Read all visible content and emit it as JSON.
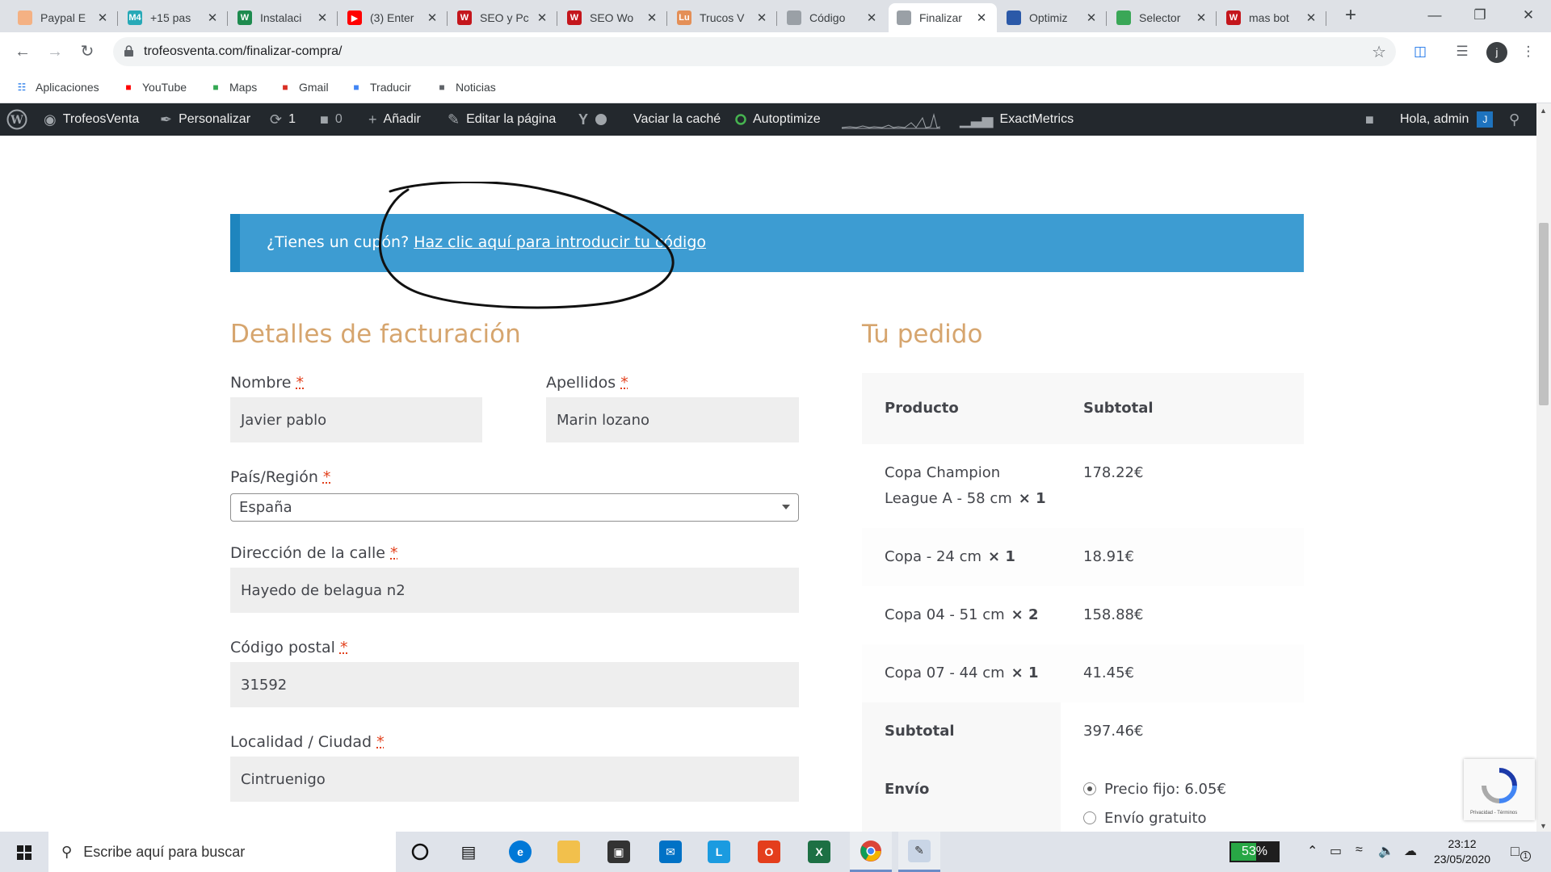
{
  "browser": {
    "tabs": [
      {
        "title": "Paypal E",
        "icon": "paypal-icon",
        "color": "#f4b183",
        "glyph": ""
      },
      {
        "title": "+15 pas",
        "icon": "m4-icon",
        "color": "#27a9b7",
        "glyph": "M4"
      },
      {
        "title": "Instalaci",
        "icon": "webempresa-icon",
        "color": "#1e8b4f",
        "glyph": "W"
      },
      {
        "title": "(3) Enter",
        "icon": "youtube-icon",
        "color": "#ff0000",
        "glyph": "▶"
      },
      {
        "title": "SEO y Pc",
        "icon": "webempresa-red-icon",
        "color": "#c4161c",
        "glyph": "W"
      },
      {
        "title": "SEO Wo",
        "icon": "webempresa-red-icon",
        "color": "#c4161c",
        "glyph": "W"
      },
      {
        "title": "Trucos V",
        "icon": "lu-icon",
        "color": "#e48f57",
        "glyph": "Lu"
      },
      {
        "title": "Código",
        "icon": "feather-icon",
        "color": "#9aa0a6",
        "glyph": ""
      },
      {
        "title": "Finalizar",
        "icon": "feather-icon",
        "color": "#9aa0a6",
        "glyph": "",
        "active": true
      },
      {
        "title": "Optimiz",
        "icon": "chart-icon",
        "color": "#2b59a8",
        "glyph": ""
      },
      {
        "title": "Selector",
        "icon": "sheet-icon",
        "color": "#3aa757",
        "glyph": ""
      },
      {
        "title": "mas bot",
        "icon": "webempresa-red-icon",
        "color": "#c4161c",
        "glyph": "W"
      }
    ],
    "url": "trofeosventa.com/finalizar-compra/",
    "profile_initial": "j"
  },
  "bookmarks": [
    {
      "label": "Aplicaciones",
      "icon": "apps-grid-icon",
      "color": "#1a73e8"
    },
    {
      "label": "YouTube",
      "icon": "youtube-icon",
      "color": "#ff0000"
    },
    {
      "label": "Maps",
      "icon": "maps-icon",
      "color": "#34a853"
    },
    {
      "label": "Gmail",
      "icon": "gmail-icon",
      "color": "#d93025"
    },
    {
      "label": "Traducir",
      "icon": "translate-icon",
      "color": "#4285f4"
    },
    {
      "label": "Noticias",
      "icon": "news-icon",
      "color": "#5f6368"
    }
  ],
  "adminbar": {
    "site": "TrofeosVenta",
    "customize": "Personalizar",
    "updates": "1",
    "comments": "0",
    "add_new": "Añadir",
    "edit_page": "Editar la página",
    "clear_cache": "Vaciar la caché",
    "autoptimize": "Autoptimize",
    "exactmetrics": "ExactMetrics",
    "greeting": "Hola, admin",
    "avatar_initial": "J"
  },
  "coupon": {
    "prompt": "¿Tienes un cupón?",
    "link": "Haz clic aquí para introducir tu código"
  },
  "billing": {
    "title": "Detalles de facturación",
    "first_name": {
      "label": "Nombre",
      "value": "Javier pablo"
    },
    "last_name": {
      "label": "Apellidos",
      "value": "Marin lozano"
    },
    "country": {
      "label": "País/Región",
      "value": "España"
    },
    "street": {
      "label": "Dirección de la calle",
      "value": "Hayedo de belagua n2"
    },
    "postcode": {
      "label": "Código postal",
      "value": "31592"
    },
    "city": {
      "label": "Localidad / Ciudad",
      "value": "Cintruenigo"
    },
    "required_mark": "*"
  },
  "order": {
    "title": "Tu pedido",
    "col_product": "Producto",
    "col_subtotal": "Subtotal",
    "items": [
      {
        "name_line1": "Copa Champion",
        "name_line2": "League A - 58 cm",
        "qty": "× 1",
        "price": "178.22€"
      },
      {
        "name_line1": "Copa - 24 cm",
        "name_line2": "",
        "qty": "× 1",
        "price": "18.91€"
      },
      {
        "name_line1": "Copa 04 - 51 cm",
        "name_line2": "",
        "qty": "× 2",
        "price": "158.88€"
      },
      {
        "name_line1": "Copa 07 - 44 cm",
        "name_line2": "",
        "qty": "× 1",
        "price": "41.45€"
      }
    ],
    "subtotal_label": "Subtotal",
    "subtotal_value": "397.46€",
    "shipping_label": "Envío",
    "shipping_options": [
      {
        "label": "Precio fijo: 6.05€",
        "selected": true
      },
      {
        "label": "Envío gratuito",
        "selected": false
      }
    ]
  },
  "recaptcha": {
    "terms": "Privacidad - Términos"
  },
  "taskbar": {
    "search_placeholder": "Escribe aquí para buscar",
    "battery_percent": "53%",
    "battery_level": 0.53,
    "time": "23:12",
    "date": "23/05/2020",
    "notifications": "1"
  }
}
